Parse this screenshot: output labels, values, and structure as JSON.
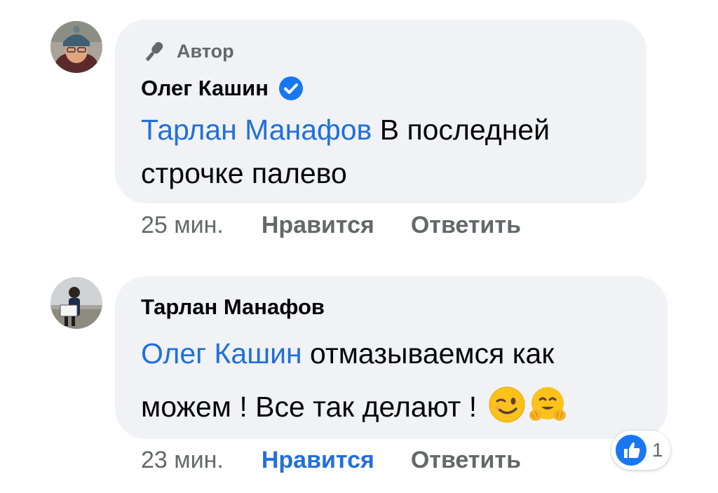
{
  "comments": [
    {
      "author_badge": "Автор",
      "author": "Олег Кашин",
      "verified": true,
      "mention": "Тарлан Манафов",
      "text_line1": " В последней",
      "text_line2": "строчке палево",
      "time": "25 мин.",
      "like_label": "Нравится",
      "reply_label": "Ответить",
      "liked": false
    },
    {
      "author": "Тарлан Манафов",
      "mention": "Олег Кашин",
      "text_line1": " отмазываемся как",
      "text_line2": "можем ! Все так делают ! ",
      "emojis": [
        "winking-face",
        "hugging-face"
      ],
      "time": "23 мин.",
      "like_label": "Нравится",
      "reply_label": "Ответить",
      "liked": true,
      "reaction_count": "1"
    }
  ],
  "colors": {
    "bubble": "#f0f2f5",
    "mention": "#216fdb",
    "secondary_text": "#65676b",
    "like_blue": "#216fdb"
  }
}
